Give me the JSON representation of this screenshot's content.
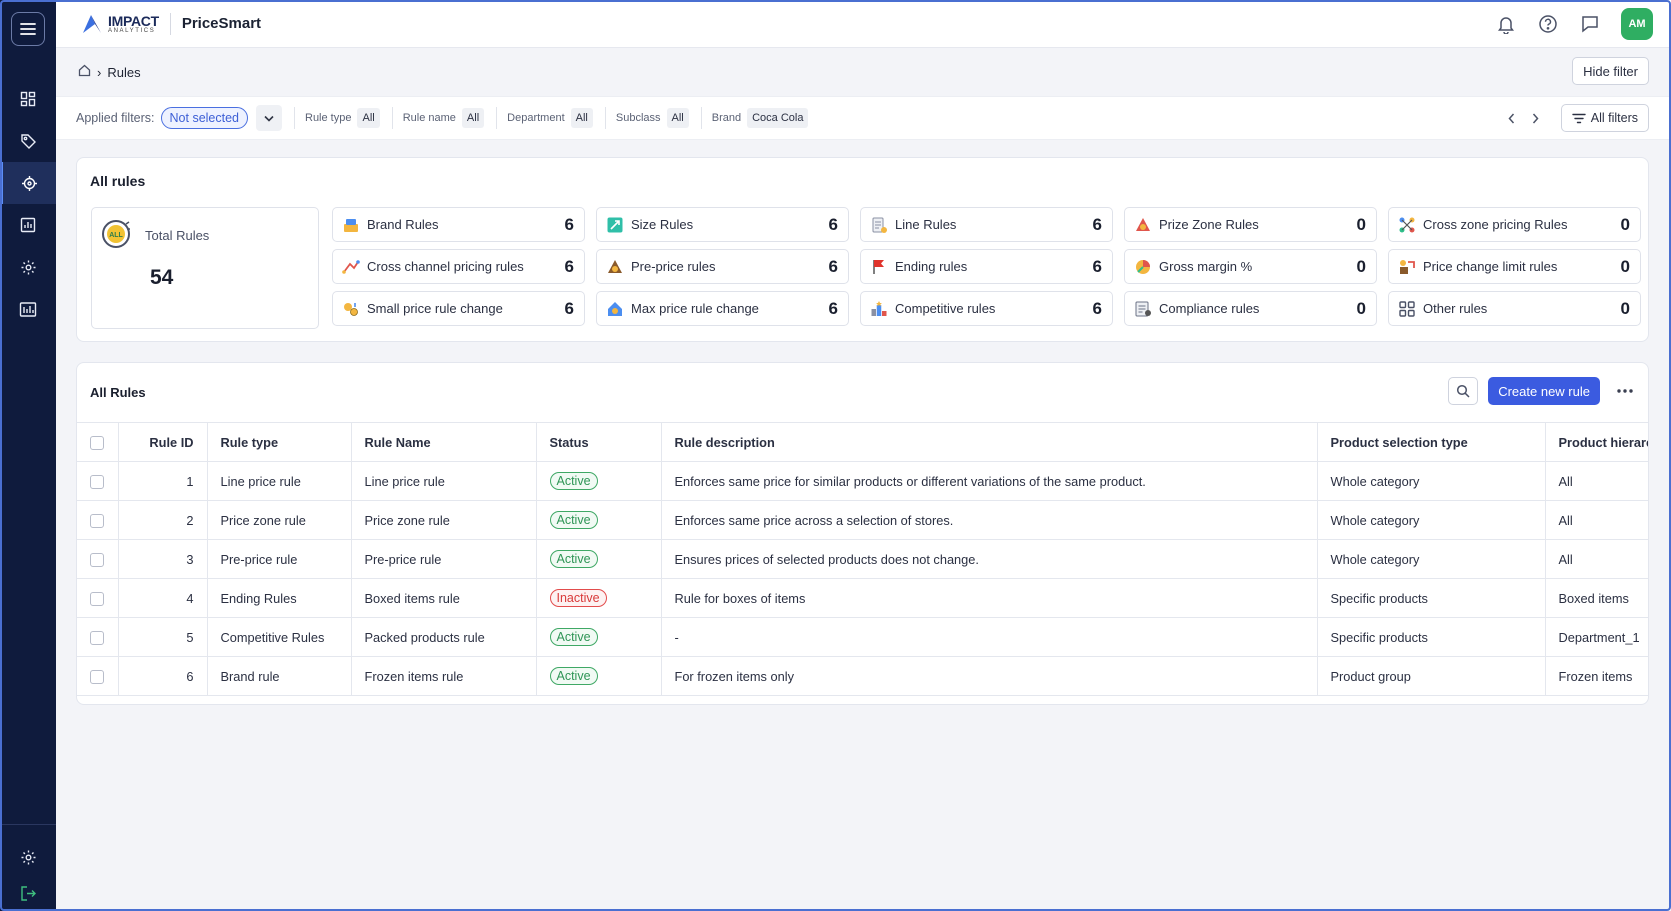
{
  "header": {
    "brand_line1": "IMPACT",
    "brand_line2": "ANALYTICS",
    "app_name": "PriceSmart",
    "avatar_initials": "AM"
  },
  "breadcrumb": {
    "current": "Rules"
  },
  "hide_filter_label": "Hide filter",
  "filters": {
    "applied_label": "Applied filters:",
    "applied_value": "Not selected",
    "items": [
      {
        "name": "Rule type",
        "value": "All"
      },
      {
        "name": "Rule name",
        "value": "All"
      },
      {
        "name": "Department",
        "value": "All"
      },
      {
        "name": "Subclass",
        "value": "All"
      },
      {
        "name": "Brand",
        "value": "Coca Cola"
      }
    ],
    "all_filters_label": "All filters"
  },
  "summary": {
    "title": "All rules",
    "total_label": "Total Rules",
    "total_value": "54",
    "tiles": [
      {
        "name": "Brand Rules",
        "count": "6",
        "icon": "brand-icon"
      },
      {
        "name": "Size Rules",
        "count": "6",
        "icon": "size-icon"
      },
      {
        "name": "Line Rules",
        "count": "6",
        "icon": "line-icon"
      },
      {
        "name": "Prize Zone Rules",
        "count": "0",
        "icon": "price-zone-icon"
      },
      {
        "name": "Cross zone pricing Rules",
        "count": "0",
        "icon": "cross-zone-icon"
      },
      {
        "name": "Cross channel pricing rules",
        "count": "6",
        "icon": "cross-channel-icon"
      },
      {
        "name": "Pre-price rules",
        "count": "6",
        "icon": "pre-price-icon"
      },
      {
        "name": "Ending rules",
        "count": "6",
        "icon": "ending-flag-icon"
      },
      {
        "name": "Gross margin %",
        "count": "0",
        "icon": "gross-margin-icon"
      },
      {
        "name": "Price change limit rules",
        "count": "0",
        "icon": "price-limit-icon"
      },
      {
        "name": "Small price rule change",
        "count": "6",
        "icon": "small-price-icon"
      },
      {
        "name": "Max price  rule change",
        "count": "6",
        "icon": "max-price-icon"
      },
      {
        "name": "Competitive rules",
        "count": "6",
        "icon": "competitive-icon"
      },
      {
        "name": "Compliance rules",
        "count": "0",
        "icon": "compliance-icon"
      },
      {
        "name": "Other rules",
        "count": "0",
        "icon": "other-grid-icon"
      }
    ]
  },
  "table": {
    "title": "All Rules",
    "create_label": "Create new rule",
    "columns": [
      "Rule ID",
      "Rule type",
      "Rule Name",
      "Status",
      "Rule description",
      "Product selection type",
      "Product hierarc"
    ],
    "rows": [
      {
        "id": "1",
        "type": "Line price rule",
        "name": "Line price rule",
        "status": "Active",
        "desc": "Enforces same price for similar products or different variations of the same product.",
        "selection": "Whole category",
        "hierarchy": "All"
      },
      {
        "id": "2",
        "type": "Price zone rule",
        "name": "Price zone rule",
        "status": "Active",
        "desc": "Enforces same price across a selection of stores.",
        "selection": "Whole category",
        "hierarchy": "All"
      },
      {
        "id": "3",
        "type": "Pre-price rule",
        "name": "Pre-price rule",
        "status": "Active",
        "desc": "Ensures prices of selected products does not change.",
        "selection": "Whole category",
        "hierarchy": "All"
      },
      {
        "id": "4",
        "type": "Ending Rules",
        "name": "Boxed items rule",
        "status": "Inactive",
        "desc": "Rule for boxes of items",
        "selection": "Specific products",
        "hierarchy": "Boxed items"
      },
      {
        "id": "5",
        "type": "Competitive Rules",
        "name": "Packed products rule",
        "status": "Active",
        "desc": "-",
        "selection": "Specific products",
        "hierarchy": "Department_1"
      },
      {
        "id": "6",
        "type": "Brand rule",
        "name": "Frozen items rule",
        "status": "Active",
        "desc": "For frozen items only",
        "selection": "Product group",
        "hierarchy": "Frozen items"
      }
    ]
  },
  "colors": {
    "sidebar": "#0f1b3d",
    "accent": "#3b5be0",
    "active_status": "#2f9556",
    "inactive_status": "#d93a3a",
    "avatar": "#2fae62"
  }
}
